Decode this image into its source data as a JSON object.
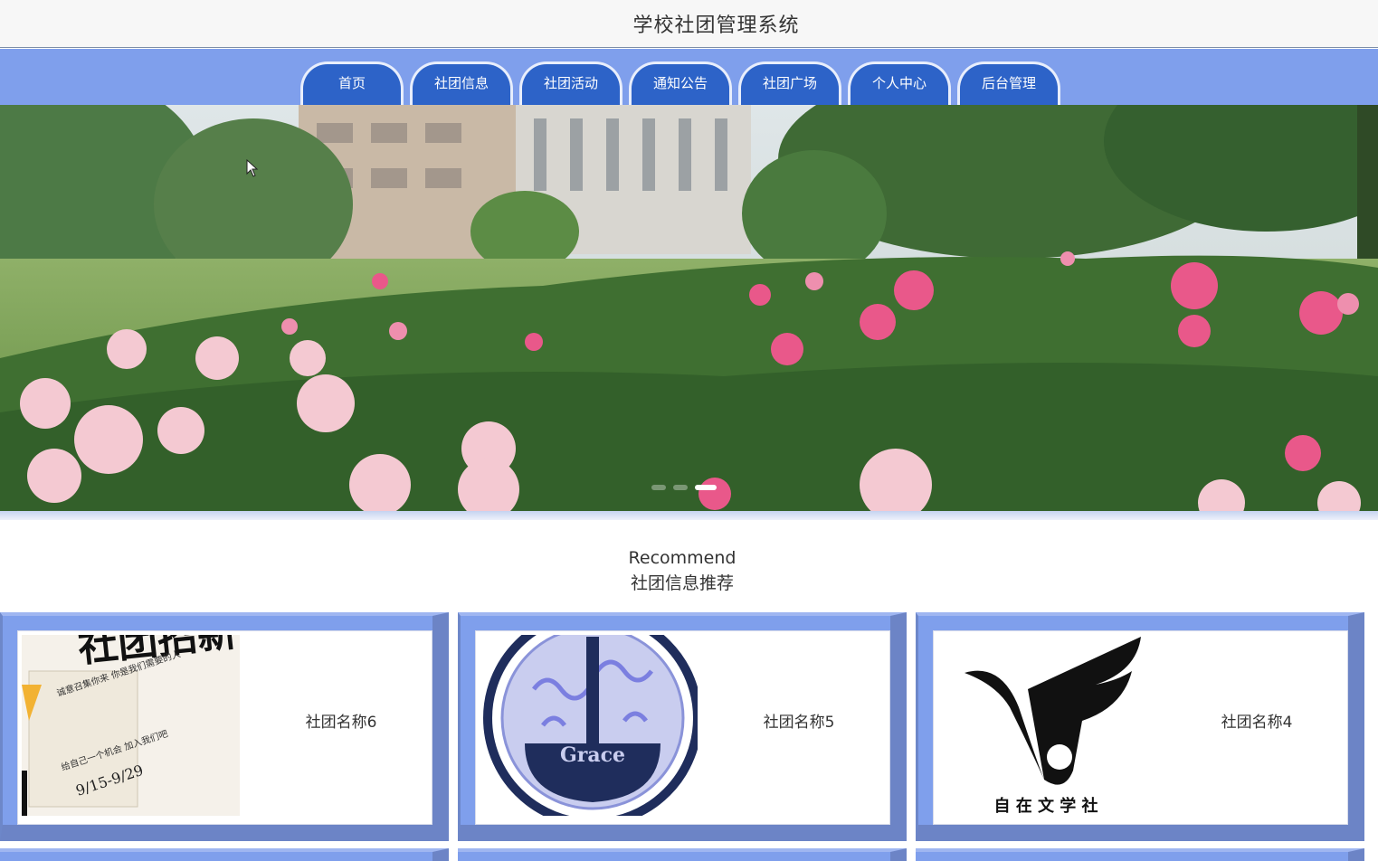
{
  "header": {
    "title": "学校社团管理系统"
  },
  "nav": {
    "items": [
      {
        "label": "首页"
      },
      {
        "label": "社团信息"
      },
      {
        "label": "社团活动"
      },
      {
        "label": "通知公告"
      },
      {
        "label": "社团广场"
      },
      {
        "label": "个人中心"
      },
      {
        "label": "后台管理"
      }
    ]
  },
  "banner": {
    "slides": 3,
    "active_index": 2
  },
  "recommend": {
    "title_en": "Recommend",
    "title_cn": "社团信息推荐",
    "cards": [
      {
        "name": "社团名称6",
        "image": "recruitment-poster-image",
        "poster_big_text": "社团招新",
        "poster_small_1": "诚意召集你来 你是我们需要的人",
        "poster_small_2": "给自己一个机会 加入我们吧",
        "poster_date": "9/15-9/29"
      },
      {
        "name": "社团名称5",
        "image": "grace-club-logo-image",
        "logo_text": "Grace"
      },
      {
        "name": "社团名称4",
        "image": "literature-club-logo-image",
        "logo_text": "自 在 文 学 社"
      }
    ]
  },
  "colors": {
    "nav_bg": "#7f9fec",
    "tab_bg": "#2d63c8",
    "card_frame": "#6c84c6"
  }
}
